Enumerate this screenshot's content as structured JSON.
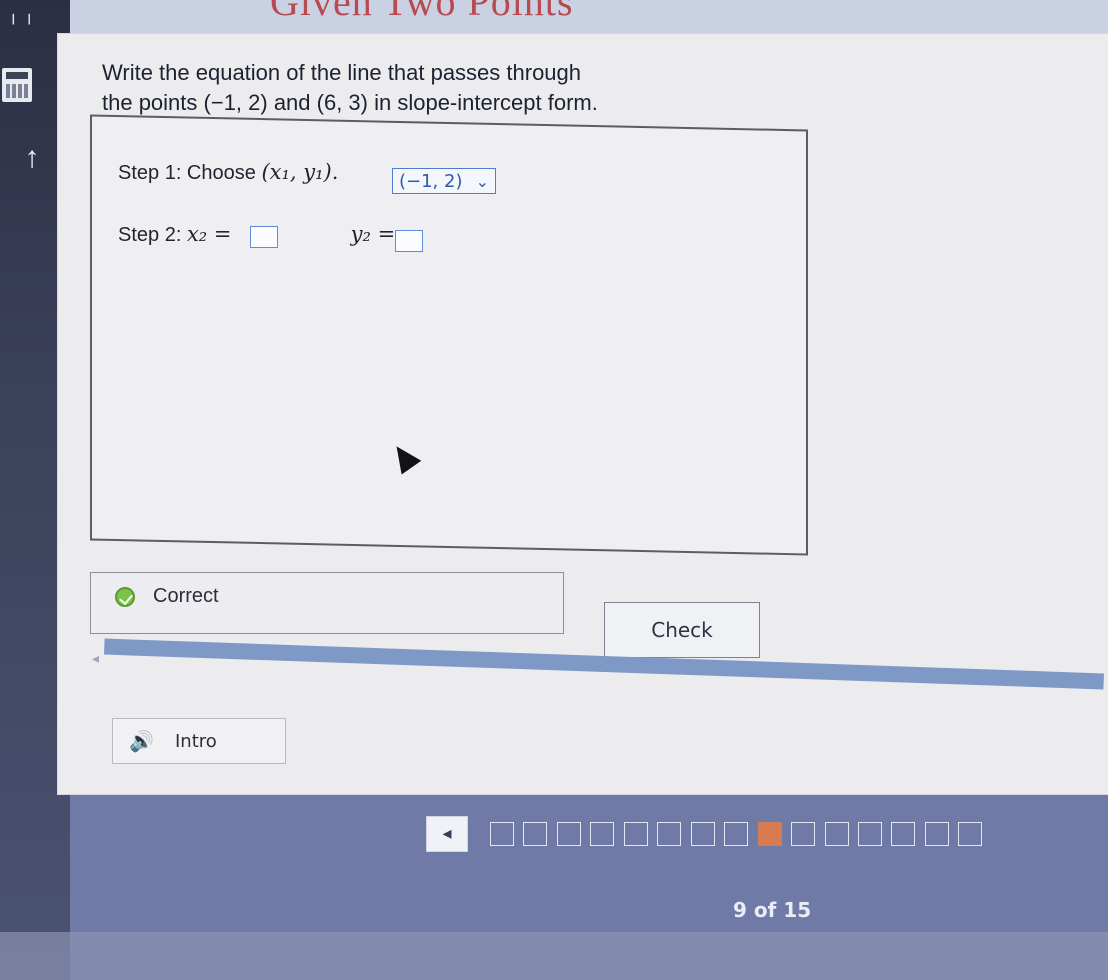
{
  "header": {
    "title_partial": "Given Two Points"
  },
  "question": {
    "line1": "Write the equation of the line that passes through",
    "line2": "the points (−1, 2) and (6, 3) in slope-intercept form."
  },
  "steps": {
    "step1_label": "Step 1: Choose",
    "step1_math": "(x₁, y₁).",
    "step1_selected": "(−1, 2)",
    "step2_label": "Step 2:",
    "x2_label": "x₂ =",
    "y2_label": "y₂ ="
  },
  "feedback": {
    "status": "Correct"
  },
  "buttons": {
    "check": "Check",
    "intro": "Intro"
  },
  "progress": {
    "page_text": "9 of 15",
    "current_page": 9,
    "total_pages": 15
  }
}
